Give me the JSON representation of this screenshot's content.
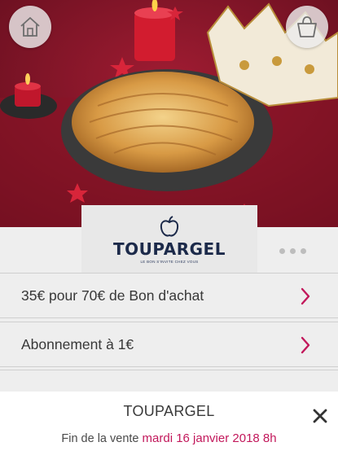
{
  "hero": {
    "image": "galette-des-rois-with-crown-and-candles",
    "home_icon": "home-icon",
    "cart_icon": "shopping-bag-icon"
  },
  "brand": {
    "name": "TOUPARGEL",
    "tagline": "LE BON S'INVITE CHEZ VOUS",
    "logo_icon": "apple-logo-icon",
    "color": "#1c2a4a"
  },
  "offers": [
    {
      "label": "35€ pour 70€ de Bon d'achat"
    },
    {
      "label": "Abonnement à 1€"
    }
  ],
  "footer": {
    "title": "TOUPARGEL",
    "sale_end_label": "Fin de la vente",
    "sale_end_date": "mardi 16 janvier 2018 8h",
    "accent_color": "#c2185b"
  }
}
